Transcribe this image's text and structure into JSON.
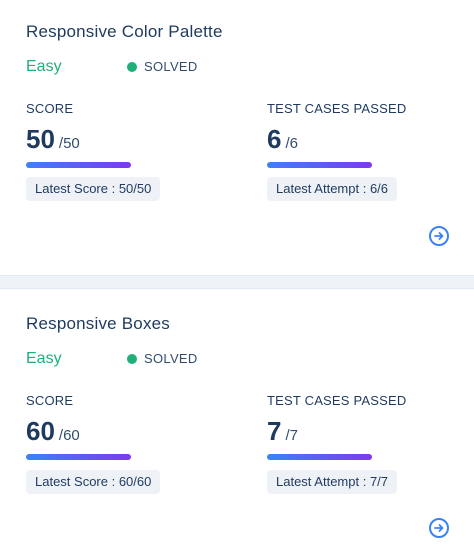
{
  "problems": [
    {
      "title": "Responsive Color Palette",
      "difficulty": "Easy",
      "status": "SOLVED",
      "score_label": "SCORE",
      "score_value": "50",
      "score_total": "/50",
      "score_progress": 1.0,
      "latest_score": "Latest Score : 50/50",
      "tests_label": "TEST CASES PASSED",
      "tests_value": "6",
      "tests_total": "/6",
      "tests_progress": 1.0,
      "latest_attempt": "Latest Attempt : 6/6",
      "open_icon": "arrow-circle-right-icon"
    },
    {
      "title": "Responsive Boxes",
      "difficulty": "Easy",
      "status": "SOLVED",
      "score_label": "SCORE",
      "score_value": "60",
      "score_total": "/60",
      "score_progress": 1.0,
      "latest_score": "Latest Score : 60/60",
      "tests_label": "TEST CASES PASSED",
      "tests_value": "7",
      "tests_total": "/7",
      "tests_progress": 1.0,
      "latest_attempt": "Latest Attempt : 7/7",
      "open_icon": "arrow-circle-right-icon"
    }
  ],
  "colors": {
    "easy": "#1fb07a",
    "solved_dot": "#1fb07a",
    "progress_start": "#3b82f6",
    "progress_end": "#7c3aed",
    "title": "#1e3a5f",
    "accent": "#3b82f6"
  }
}
